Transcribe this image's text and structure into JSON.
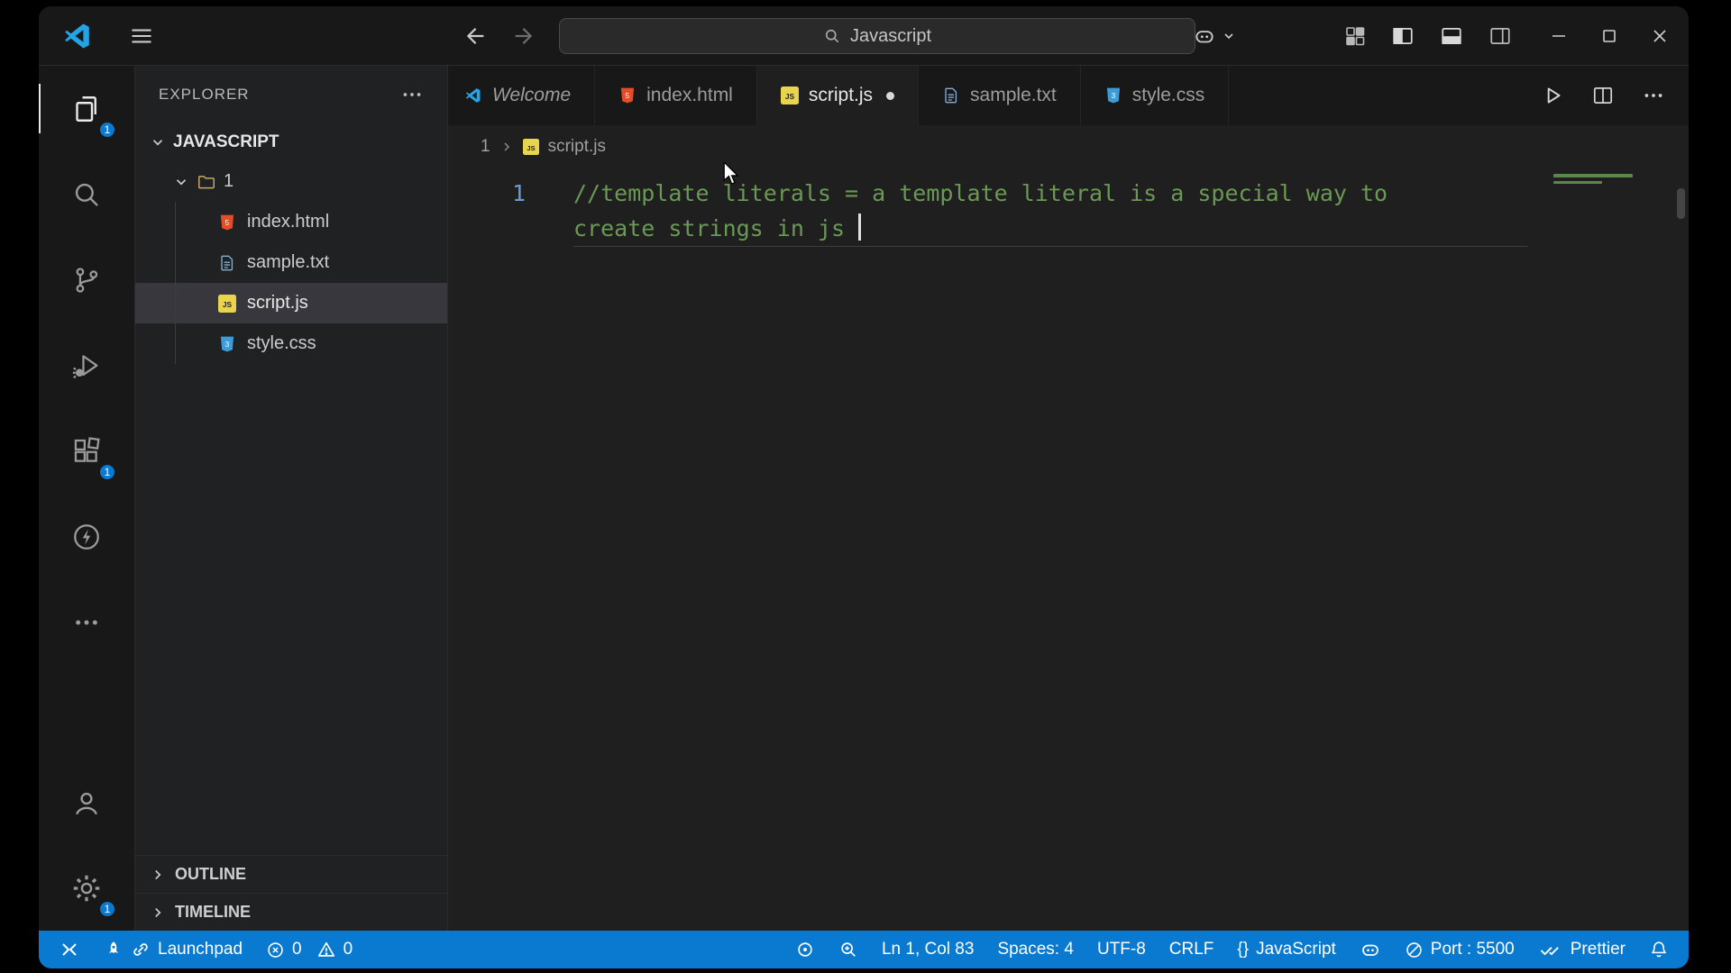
{
  "colors": {
    "statusbar_blue": "#0a79d0",
    "badge_blue": "#0a79d0",
    "comment_green": "#6a9955",
    "titlebar_bg": "#181818",
    "editor_bg": "#1f1f1f",
    "js_yellow": "#e8d44d",
    "html_orange": "#e44d26",
    "css_blue": "#3c9cd7"
  },
  "titlebar": {
    "search_value": "Javascript"
  },
  "activity_bar": {
    "explorer_badge": "1",
    "extensions_badge": "1",
    "settings_badge": "1"
  },
  "sidebar": {
    "header": "EXPLORER",
    "section_label": "JAVASCRIPT",
    "folder_label": "1",
    "files": [
      {
        "name": "index.html"
      },
      {
        "name": "sample.txt"
      },
      {
        "name": "script.js"
      },
      {
        "name": "style.css"
      }
    ],
    "outline_label": "OUTLINE",
    "timeline_label": "TIMELINE"
  },
  "editor": {
    "tabs": [
      {
        "label": "Welcome"
      },
      {
        "label": "index.html"
      },
      {
        "label": "script.js"
      },
      {
        "label": "sample.txt"
      },
      {
        "label": "style.css"
      }
    ],
    "breadcrumb": {
      "folder": "1",
      "file": "script.js"
    },
    "line_number": "1",
    "code_line_1": "//template literals = a template literal is a special way to",
    "code_line_2": "create strings in js"
  },
  "statusbar": {
    "launchpad": "Launchpad",
    "errors": "0",
    "warnings": "0",
    "cursor_position": "Ln 1, Col 83",
    "indentation": "Spaces: 4",
    "encoding": "UTF-8",
    "eol": "CRLF",
    "braces": "{}",
    "language": "JavaScript",
    "port": "Port : 5500",
    "formatter": "Prettier"
  }
}
